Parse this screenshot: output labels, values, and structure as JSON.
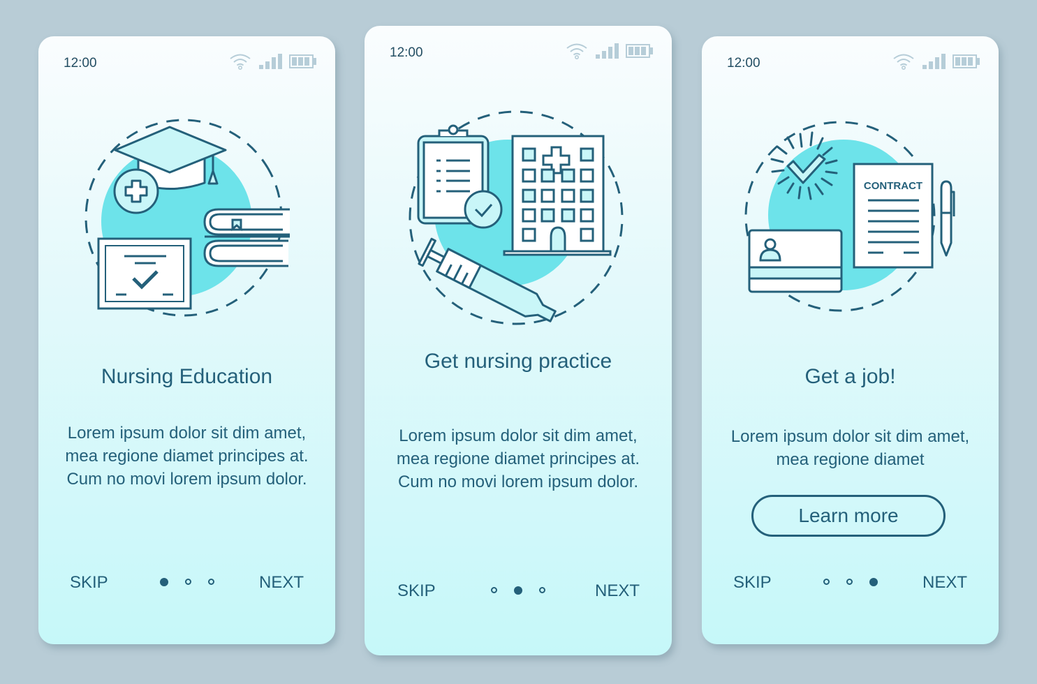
{
  "colors": {
    "background": "#b8ccd6",
    "accent": "#24607a",
    "illustration_fill": "#6de3ea",
    "status_icon": "#b6cdd8"
  },
  "screens": [
    {
      "status": {
        "time": "12:00",
        "icons": [
          "wifi-icon",
          "signal-icon",
          "battery-icon"
        ]
      },
      "illustration": "nursing-education-illustration",
      "title": "Nursing Education",
      "body": "Lorem ipsum dolor sit dim amet, mea regione diamet principes at. Cum no movi lorem ipsum dolor.",
      "footer": {
        "skip": "SKIP",
        "next": "NEXT",
        "page_index": 1,
        "page_count": 3
      }
    },
    {
      "status": {
        "time": "12:00",
        "icons": [
          "wifi-icon",
          "signal-icon",
          "battery-icon"
        ]
      },
      "illustration": "nursing-practice-illustration",
      "title": "Get nursing practice",
      "body": "Lorem ipsum dolor sit dim amet, mea regione diamet principes at. Cum no movi lorem ipsum dolor.",
      "footer": {
        "skip": "SKIP",
        "next": "NEXT",
        "page_index": 2,
        "page_count": 3
      }
    },
    {
      "status": {
        "time": "12:00",
        "icons": [
          "wifi-icon",
          "signal-icon",
          "battery-icon"
        ]
      },
      "illustration": "get-a-job-illustration",
      "contract_label": "CONTRACT",
      "title": "Get a job!",
      "body": "Lorem ipsum dolor sit dim amet, mea regione diamet",
      "button": "Learn more",
      "footer": {
        "skip": "SKIP",
        "next": "NEXT",
        "page_index": 3,
        "page_count": 3
      }
    }
  ]
}
